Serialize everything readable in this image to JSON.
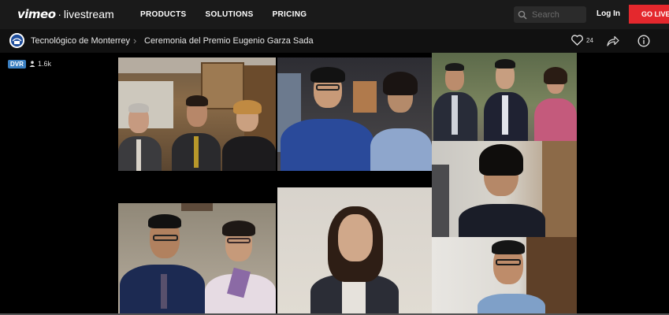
{
  "nav": {
    "brand_vimeo": "vimeo",
    "brand_sep": "·",
    "brand_live": "livestream",
    "links": [
      "PRODUCTS",
      "SOLUTIONS",
      "PRICING"
    ],
    "search_placeholder": "Search",
    "login": "Log In",
    "golive": "GO LIVE"
  },
  "event": {
    "org": "Tecnológico de Monterrey",
    "separator": "›",
    "title": "Ceremonia del Premio Eugenio Garza Sada",
    "likes": "24"
  },
  "player": {
    "dvr": "DVR",
    "viewers": "1.6k"
  },
  "icons": [
    "search-icon",
    "org-logo-icon",
    "heart-icon",
    "share-icon",
    "info-icon",
    "person-icon"
  ],
  "colors": {
    "accent_red": "#e4282d",
    "dvr_blue": "#3a7fc1"
  }
}
